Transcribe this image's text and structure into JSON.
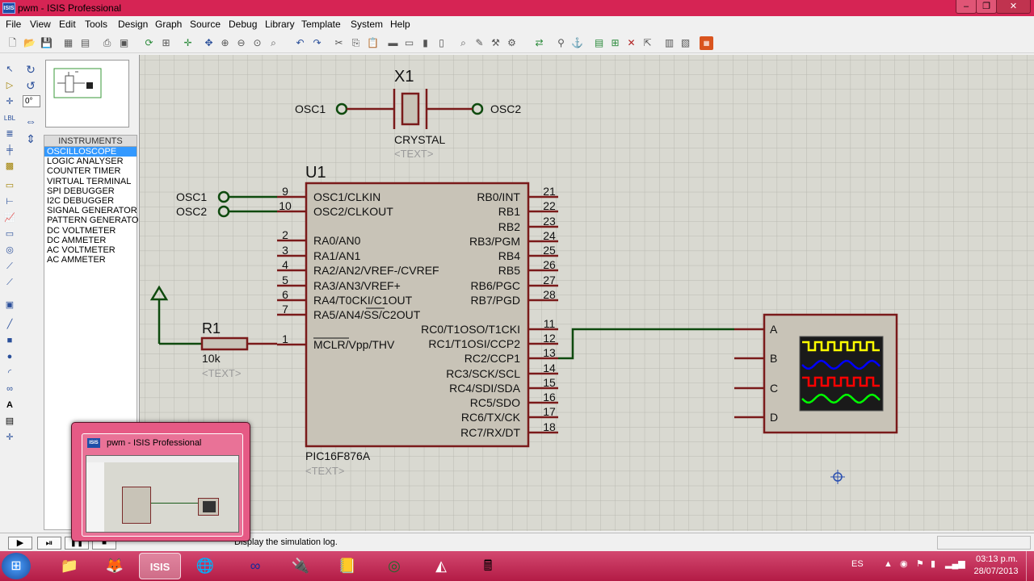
{
  "window": {
    "title": "pwm - ISIS Professional",
    "app_icon_text": "ISIS"
  },
  "window_controls": {
    "minimize": "–",
    "restore": "❐",
    "close": "✕"
  },
  "menu": [
    "File",
    "View",
    "Edit",
    "Tools",
    "Design",
    "Graph",
    "Source",
    "Debug",
    "Library",
    "Template",
    "System",
    "Help"
  ],
  "rotation": {
    "angle": "0°"
  },
  "devices": {
    "header": "INSTRUMENTS",
    "items": [
      "OSCILLOSCOPE",
      "LOGIC ANALYSER",
      "COUNTER TIMER",
      "VIRTUAL TERMINAL",
      "SPI DEBUGGER",
      "I2C DEBUGGER",
      "SIGNAL GENERATOR",
      "PATTERN GENERATOR",
      "DC VOLTMETER",
      "DC AMMETER",
      "AC VOLTMETER",
      "AC AMMETER"
    ],
    "selected": "OSCILLOSCOPE"
  },
  "schematic": {
    "crystal": {
      "ref": "X1",
      "value": "CRYSTAL",
      "text": "<TEXT>",
      "left_term": "OSC1",
      "right_term": "OSC2"
    },
    "mcu": {
      "ref": "U1",
      "part": "PIC16F876A",
      "text": "<TEXT>",
      "left_pins": [
        {
          "num": "9",
          "name": "OSC1/CLKIN"
        },
        {
          "num": "10",
          "name": "OSC2/CLKOUT"
        },
        {
          "num": "2",
          "name": "RA0/AN0"
        },
        {
          "num": "3",
          "name": "RA1/AN1"
        },
        {
          "num": "4",
          "name": "RA2/AN2/VREF-/CVREF"
        },
        {
          "num": "5",
          "name": "RA3/AN3/VREF+"
        },
        {
          "num": "6",
          "name": "RA4/T0CKI/C1OUT"
        },
        {
          "num": "7",
          "name": "RA5/AN4/SS/C2OUT"
        },
        {
          "num": "1",
          "name": "MCLR/Vpp/THV"
        }
      ],
      "right_pins": [
        {
          "num": "21",
          "name": "RB0/INT"
        },
        {
          "num": "22",
          "name": "RB1"
        },
        {
          "num": "23",
          "name": "RB2"
        },
        {
          "num": "24",
          "name": "RB3/PGM"
        },
        {
          "num": "25",
          "name": "RB4"
        },
        {
          "num": "26",
          "name": "RB5"
        },
        {
          "num": "27",
          "name": "RB6/PGC"
        },
        {
          "num": "28",
          "name": "RB7/PGD"
        },
        {
          "num": "11",
          "name": "RC0/T1OSO/T1CKI"
        },
        {
          "num": "12",
          "name": "RC1/T1OSI/CCP2"
        },
        {
          "num": "13",
          "name": "RC2/CCP1"
        },
        {
          "num": "14",
          "name": "RC3/SCK/SCL"
        },
        {
          "num": "15",
          "name": "RC4/SDI/SDA"
        },
        {
          "num": "16",
          "name": "RC5/SDO"
        },
        {
          "num": "17",
          "name": "RC6/TX/CK"
        },
        {
          "num": "18",
          "name": "RC7/RX/DT"
        }
      ]
    },
    "osc_terms": [
      "OSC1",
      "OSC2"
    ],
    "resistor": {
      "ref": "R1",
      "value": "10k",
      "text": "<TEXT>"
    },
    "scope": {
      "channels": [
        "A",
        "B",
        "C",
        "D"
      ],
      "trace_colors": [
        "#ffff00",
        "#0000ff",
        "#ff0000",
        "#00ff00"
      ]
    }
  },
  "status": {
    "message": "Display the simulation log."
  },
  "taskbar": {
    "lang": "ES",
    "time": "03:13 p.m.",
    "date": "28/07/2013"
  },
  "thumbnail": {
    "title": "pwm - ISIS Professional",
    "icon_text": "ISIS"
  }
}
